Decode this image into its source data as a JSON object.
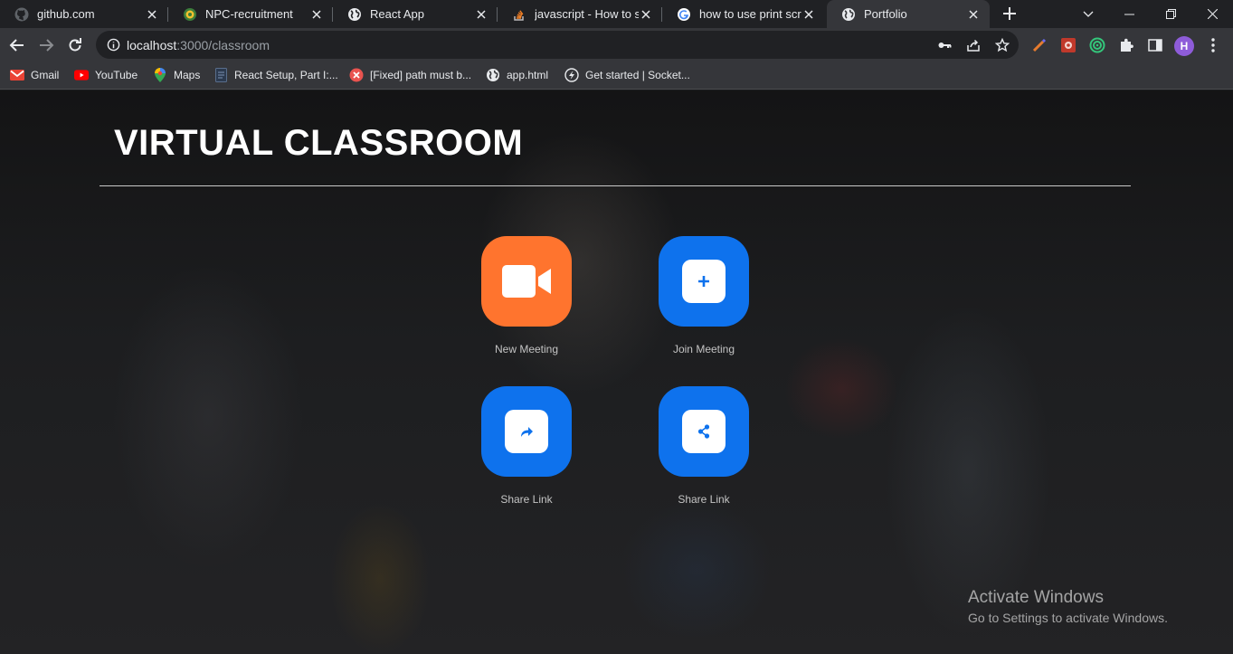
{
  "browser": {
    "tabs": [
      {
        "title": "github.com",
        "favicon": "github-icon",
        "active": false
      },
      {
        "title": "NPC-recruitment",
        "favicon": "recruitment-site-icon",
        "active": false
      },
      {
        "title": "React App",
        "favicon": "globe-icon",
        "active": false
      },
      {
        "title": "javascript - How to se",
        "favicon": "stackoverflow-icon",
        "active": false
      },
      {
        "title": "how to use print scree",
        "favicon": "google-icon",
        "active": false
      },
      {
        "title": "Portfolio",
        "favicon": "globe-icon",
        "active": true
      }
    ],
    "address": {
      "host": "localhost",
      "rest": ":3000/classroom"
    },
    "profile_initial": "H",
    "bookmarks": [
      {
        "label": "Gmail",
        "icon": "gmail-icon"
      },
      {
        "label": "YouTube",
        "icon": "youtube-icon"
      },
      {
        "label": "Maps",
        "icon": "maps-icon"
      },
      {
        "label": "React Setup, Part I:...",
        "icon": "document-icon"
      },
      {
        "label": "[Fixed] path must b...",
        "icon": "error-icon"
      },
      {
        "label": "app.html",
        "icon": "globe-icon"
      },
      {
        "label": "Get started | Socket...",
        "icon": "socketio-icon"
      }
    ]
  },
  "page": {
    "title": "VIRTUAL CLASSROOM",
    "actions": [
      {
        "label": "New Meeting",
        "icon": "video-camera-icon",
        "color": "#ff742e"
      },
      {
        "label": "Join Meeting",
        "icon": "plus-icon",
        "color": "#0e72ed"
      },
      {
        "label": "Share Link",
        "icon": "share-arrow-icon",
        "color": "#0e72ed"
      },
      {
        "label": "Share Link",
        "icon": "share-nodes-icon",
        "color": "#0e72ed"
      }
    ]
  },
  "watermark": {
    "heading": "Activate Windows",
    "subtext": "Go to Settings to activate Windows."
  }
}
